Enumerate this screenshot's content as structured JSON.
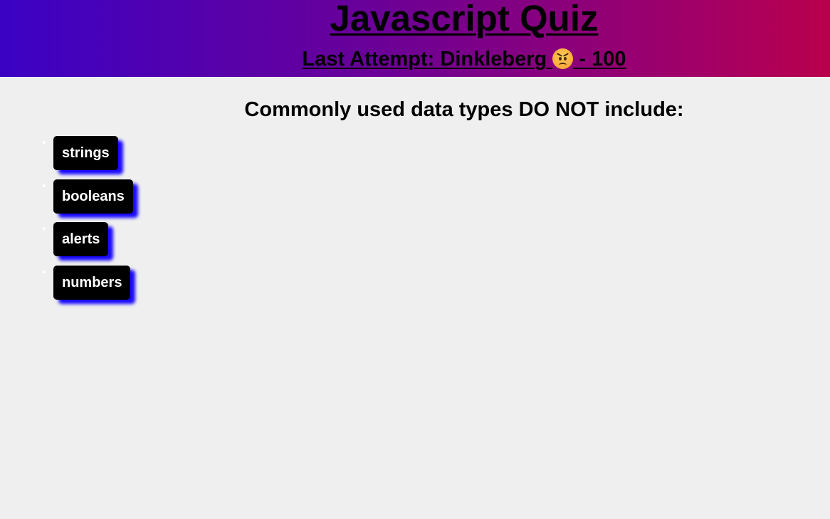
{
  "header": {
    "title": "Javascript Quiz",
    "last_attempt_prefix": "Last Attempt: Dinkleberg ",
    "last_attempt_emoji": "angry-face-icon",
    "last_attempt_suffix": " - 100"
  },
  "question": {
    "text": "Commonly used data types DO NOT include:"
  },
  "answers": [
    {
      "label": "strings"
    },
    {
      "label": "booleans"
    },
    {
      "label": "alerts"
    },
    {
      "label": "numbers"
    }
  ],
  "colors": {
    "header_gradient_start": "#3b02c4",
    "header_gradient_end": "#b9004c",
    "background": "#efefef",
    "button_bg": "#000000",
    "button_text": "#ffffff",
    "button_shadow": "#1a0aff"
  }
}
